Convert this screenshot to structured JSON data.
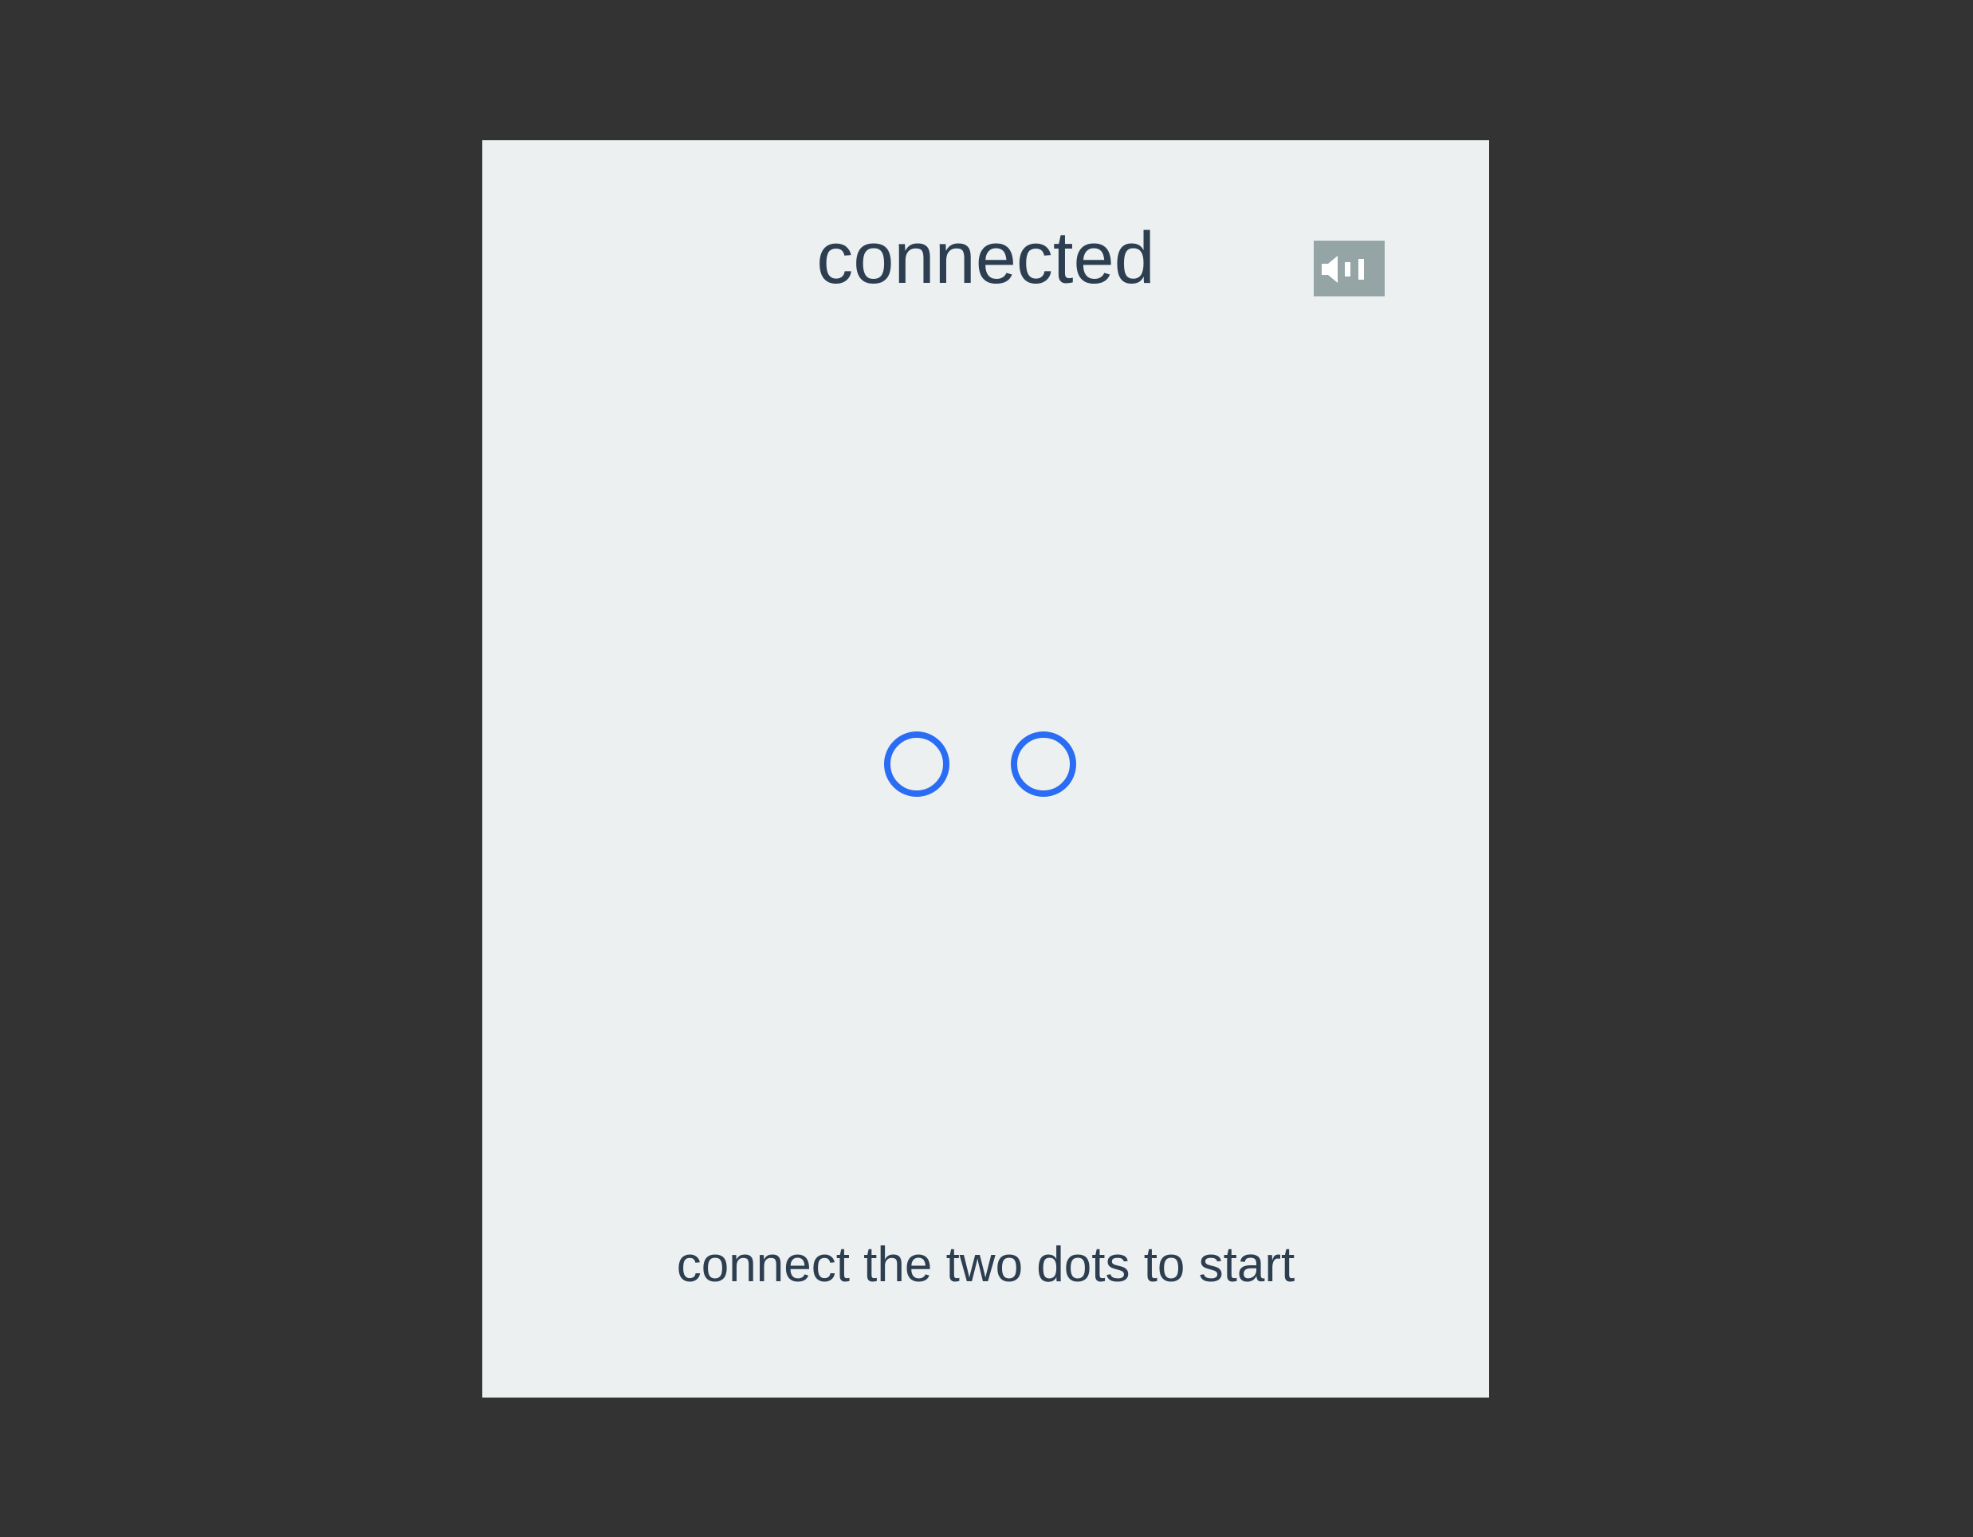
{
  "game": {
    "title": "connected",
    "instruction": "connect the two dots to start"
  },
  "controls": {
    "sound_icon": "speaker-icon"
  },
  "dots": [
    {
      "name": "dot-left"
    },
    {
      "name": "dot-right"
    }
  ],
  "colors": {
    "background": "#333333",
    "panel": "#ecf0f1",
    "text": "#2c3e50",
    "dot_stroke": "#2a6df4",
    "sound_button": "#95a5a6"
  }
}
